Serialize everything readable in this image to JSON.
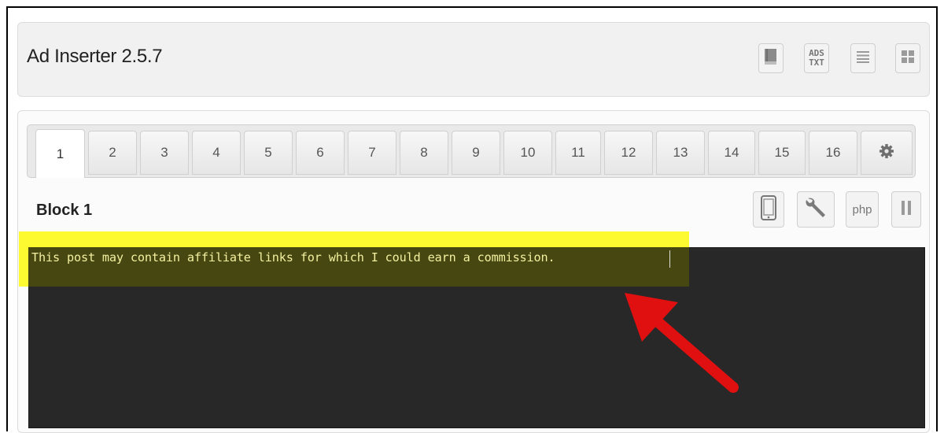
{
  "app": {
    "title": "Ad Inserter 2.5.7"
  },
  "header_buttons": [
    {
      "name": "book-icon"
    },
    {
      "name": "ads-txt-icon",
      "label_top": "ADS",
      "label_bottom": "TXT"
    },
    {
      "name": "list-icon"
    },
    {
      "name": "grid-icon"
    }
  ],
  "tabs": [
    "1",
    "2",
    "3",
    "4",
    "5",
    "6",
    "7",
    "8",
    "9",
    "10",
    "11",
    "12",
    "13",
    "14",
    "15",
    "16"
  ],
  "active_tab": "1",
  "settings_tab": {
    "icon": "gear-icon"
  },
  "block": {
    "title": "Block 1"
  },
  "block_buttons": [
    {
      "name": "mobile-icon"
    },
    {
      "name": "wrench-icon"
    },
    {
      "name": "php-button",
      "label": "php"
    },
    {
      "name": "pause-icon"
    }
  ],
  "editor": {
    "content": "This post may contain affiliate links for which I could earn a commission."
  },
  "colors": {
    "highlight": "#fffa00",
    "editor_bg": "#282828",
    "editor_text": "#f3f0a0",
    "arrow": "#e01010"
  }
}
